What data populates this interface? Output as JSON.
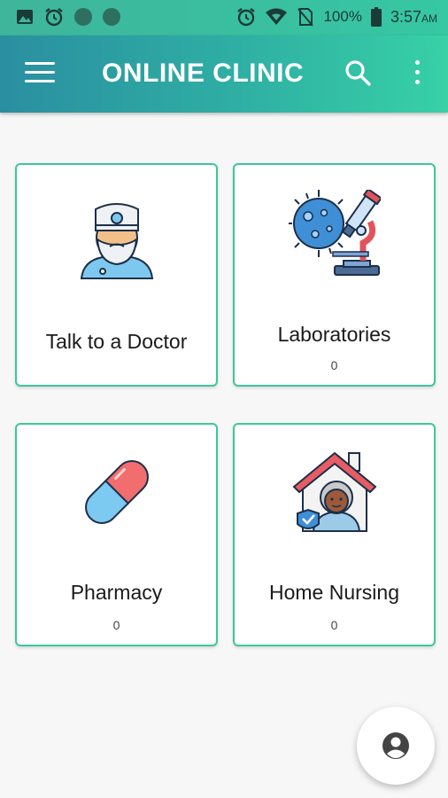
{
  "status_bar": {
    "battery_percent": "100%",
    "time": "3:57",
    "am_pm": "AM",
    "icons": [
      "image-icon",
      "alarm-icon",
      "dot-icon",
      "dot-icon",
      "alarm-icon",
      "wifi-icon",
      "no-sim-icon",
      "battery-icon"
    ]
  },
  "app_bar": {
    "title": "ONLINE CLINIC",
    "icons": [
      "menu-icon",
      "search-icon",
      "more-vert-icon"
    ],
    "colors": {
      "gradient_start": "#2a8fa0",
      "gradient_end": "#37d1a6"
    }
  },
  "cards": {
    "doctor": {
      "label": "Talk to a Doctor",
      "icon": "doctor-icon"
    },
    "laboratories": {
      "label": "Laboratories",
      "count": "0",
      "icon": "microscope-virus-icon"
    },
    "pharmacy": {
      "label": "Pharmacy",
      "count": "0",
      "icon": "pill-capsule-icon"
    },
    "home_nursing": {
      "label": "Home Nursing",
      "count": "0",
      "icon": "house-nurse-icon"
    }
  },
  "fab": {
    "icon": "account-circle-icon"
  },
  "colors": {
    "card_border": "#3cc79d",
    "background": "#f7f7f7"
  }
}
